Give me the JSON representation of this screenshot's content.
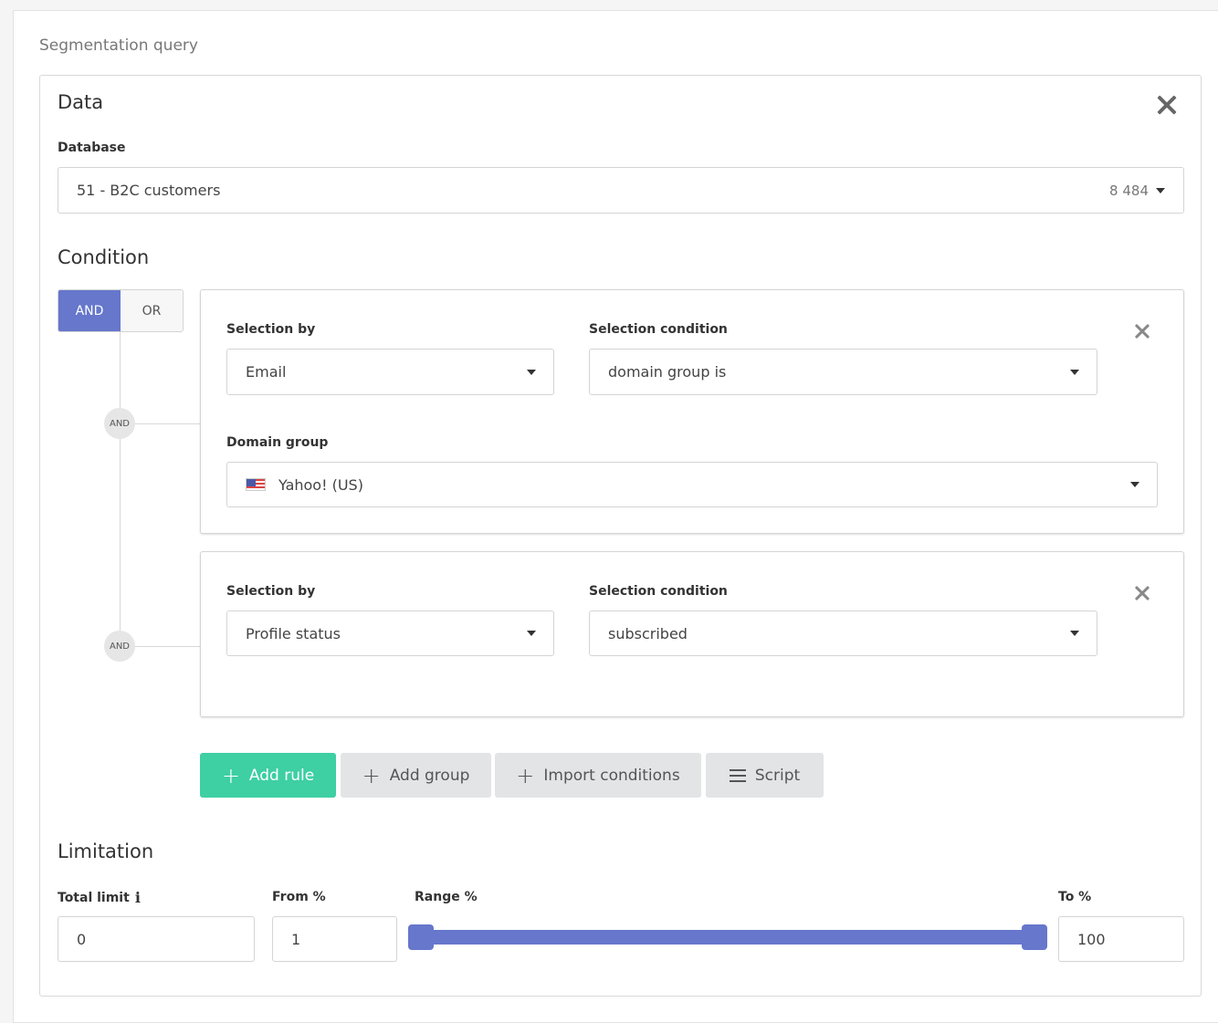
{
  "page": {
    "title": "Segmentation query"
  },
  "data_section": {
    "title": "Data",
    "database_label": "Database",
    "database_value": "51 - B2C customers",
    "database_count": "8 484"
  },
  "condition": {
    "title": "Condition",
    "toggle": {
      "and": "AND",
      "or": "OR",
      "selected": "AND"
    },
    "connector_label": "AND",
    "rules": [
      {
        "selection_by_label": "Selection by",
        "selection_by_value": "Email",
        "selection_condition_label": "Selection condition",
        "selection_condition_value": "domain group is",
        "extra_label": "Domain group",
        "extra_value": "Yahoo! (US)",
        "extra_icon": "us-flag-icon"
      },
      {
        "selection_by_label": "Selection by",
        "selection_by_value": "Profile status",
        "selection_condition_label": "Selection condition",
        "selection_condition_value": "subscribed"
      }
    ],
    "buttons": {
      "add_rule": "Add rule",
      "add_group": "Add group",
      "import_conditions": "Import conditions",
      "script": "Script"
    }
  },
  "limitation": {
    "title": "Limitation",
    "total_limit_label": "Total limit",
    "total_limit_value": "0",
    "from_label": "From %",
    "from_value": "1",
    "range_label": "Range %",
    "to_label": "To %",
    "to_value": "100",
    "range_min": 1,
    "range_max": 100
  },
  "colors": {
    "accent": "#6677cc",
    "primary_button": "#3ecfa3",
    "gray_button": "#e2e4e6"
  }
}
